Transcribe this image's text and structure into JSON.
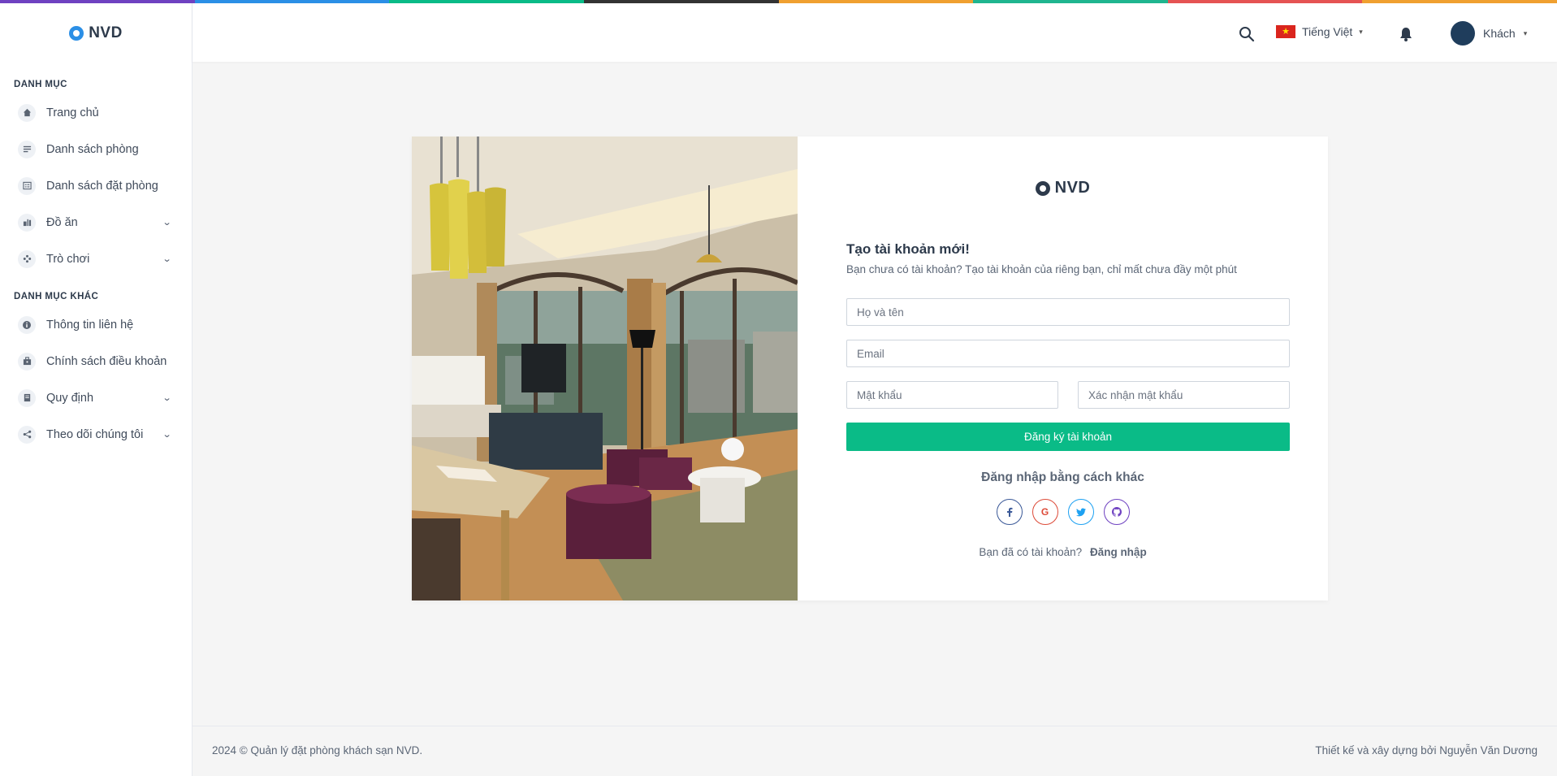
{
  "topline_colors": [
    "#6f42c1",
    "#2b8fe6",
    "#0abb87",
    "#333333",
    "#f0a030",
    "#1fb58f",
    "#e55353",
    "#f0a030"
  ],
  "brand": {
    "name": "NVD"
  },
  "sidebar": {
    "section1": "DANH MỤC",
    "items1": [
      {
        "label": "Trang chủ",
        "icon": "home-icon"
      },
      {
        "label": "Danh sách phòng",
        "icon": "list-icon"
      },
      {
        "label": "Danh sách đặt phòng",
        "icon": "booking-list-icon"
      },
      {
        "label": "Đồ ăn",
        "icon": "food-icon",
        "expandable": true
      },
      {
        "label": "Trò chơi",
        "icon": "gamepad-icon",
        "expandable": true
      }
    ],
    "section2": "DANH MỤC KHÁC",
    "items2": [
      {
        "label": "Thông tin liên hệ",
        "icon": "info-icon"
      },
      {
        "label": "Chính sách điều khoản",
        "icon": "policy-icon"
      },
      {
        "label": "Quy định",
        "icon": "rules-icon",
        "expandable": true
      },
      {
        "label": "Theo dõi chúng tôi",
        "icon": "share-icon",
        "expandable": true
      }
    ]
  },
  "header": {
    "language": "Tiếng Việt",
    "user": "Khách"
  },
  "form": {
    "title": "Tạo tài khoản mới!",
    "subtitle": "Bạn chưa có tài khoản? Tạo tài khoản của riêng bạn, chỉ mất chưa đầy một phút",
    "fullname_placeholder": "Họ và tên",
    "email_placeholder": "Email",
    "password_placeholder": "Mật khẩu",
    "confirm_placeholder": "Xác nhận mật khẩu",
    "register_label": "Đăng ký tài khoản",
    "alt_login_title": "Đăng nhập bằng cách khác",
    "socials": [
      "f",
      "G",
      "t",
      "gh"
    ],
    "have_account": "Bạn đã có tài khoản?",
    "login_link": "Đăng nhập"
  },
  "footer": {
    "left": "2024 © Quản lý đặt phòng khách sạn NVD.",
    "right": "Thiết kế và xây dựng bởi Nguyễn Văn Dương"
  }
}
